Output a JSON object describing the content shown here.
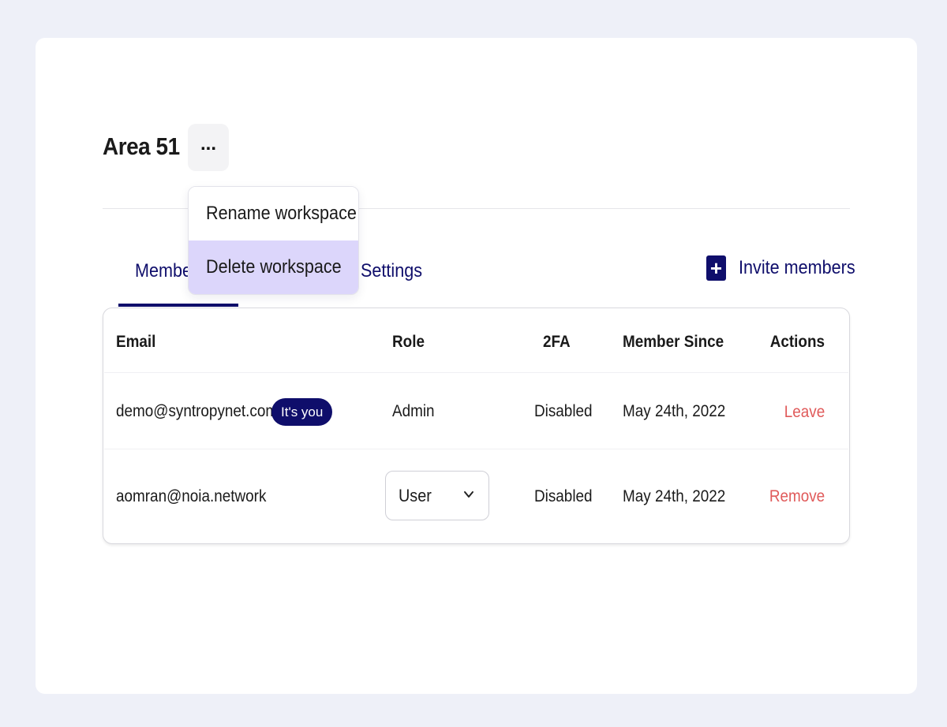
{
  "workspace": {
    "name": "Area 51",
    "more_label": "..."
  },
  "menu": {
    "items": [
      {
        "label": "Rename workspace",
        "highlighted": false
      },
      {
        "label": "Delete workspace",
        "highlighted": true
      }
    ]
  },
  "tabs": [
    {
      "label": "Members",
      "active": true
    },
    {
      "label": "Settings",
      "active": false
    }
  ],
  "invite": {
    "icon": "plus-icon",
    "label": "Invite members"
  },
  "table": {
    "headers": [
      "Email",
      "Role",
      "2FA",
      "Member Since",
      "Actions"
    ],
    "rows": [
      {
        "email": "demo@syntropynet.com",
        "badge": "It's you",
        "role": "Admin",
        "twofa": "Disabled",
        "member_since": "May 24th, 2022",
        "action": "Leave"
      },
      {
        "email": "aomran@noia.network",
        "role": "User",
        "twofa": "Disabled",
        "member_since": "May 24th, 2022",
        "action": "Remove"
      }
    ]
  },
  "colors": {
    "brand": "#0f0e6b",
    "danger": "#e05a5a",
    "menu_highlight": "#dcd6fb",
    "page_bg": "#eef0f8"
  }
}
